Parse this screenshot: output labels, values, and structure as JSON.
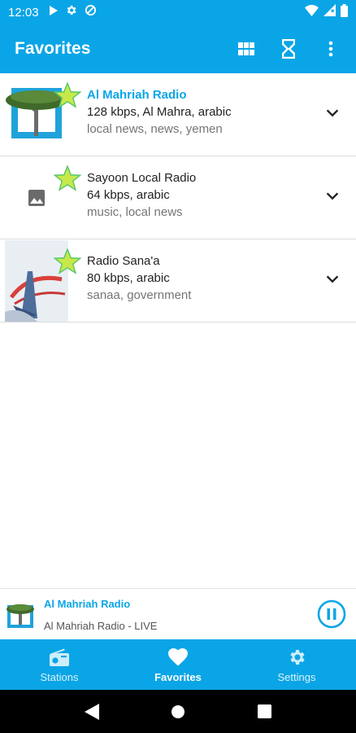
{
  "status_bar": {
    "time": "12:03"
  },
  "app_bar": {
    "title": "Favorites",
    "actions": [
      "grid-icon",
      "hourglass-icon",
      "more-vert-icon"
    ]
  },
  "stations": [
    {
      "name": "Al Mahriah Radio",
      "meta": "128 kbps, Al Mahra, arabic",
      "tags": "local news, news, yemen",
      "active": true,
      "favorite": true
    },
    {
      "name": "Sayoon Local Radio",
      "meta": "64 kbps, arabic",
      "tags": "music, local news",
      "active": false,
      "favorite": true
    },
    {
      "name": "Radio Sana'a",
      "meta": "80 kbps, arabic",
      "tags": "sanaa, government",
      "active": false,
      "favorite": true
    }
  ],
  "now_playing": {
    "title": "Al Mahriah Radio",
    "subtitle": "Al Mahriah Radio - LIVE"
  },
  "bottom_nav": {
    "items": [
      {
        "label": "Stations",
        "icon": "radio-icon"
      },
      {
        "label": "Favorites",
        "icon": "heart-icon"
      },
      {
        "label": "Settings",
        "icon": "gear-icon"
      }
    ],
    "selected": "Favorites"
  },
  "colors": {
    "primary": "#0aa5e6",
    "star": "#c8e84a"
  }
}
